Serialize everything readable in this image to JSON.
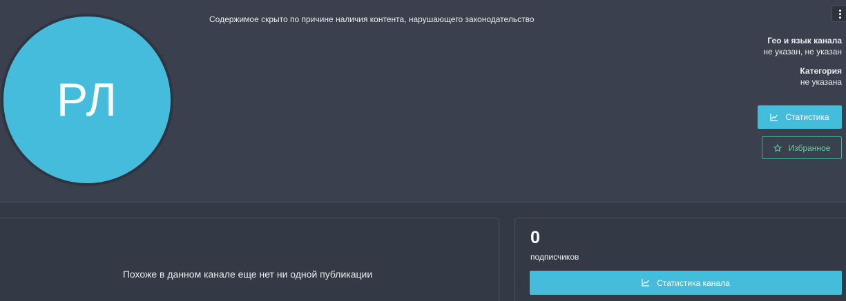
{
  "channel": {
    "initials": "РЛ",
    "hidden_notice": "Содержимое скрыто по причине наличия контента, нарушающего законодательство"
  },
  "sidebar_info": {
    "geo_label": "Гео и язык канала",
    "geo_value": "не указан, не указан",
    "category_label": "Категория",
    "category_value": "не указана"
  },
  "actions": {
    "stats_label": "Статистика",
    "favorite_label": "Избранное"
  },
  "posts": {
    "empty_text": "Похоже в данном канале еще нет ни одной публикации"
  },
  "subscribers": {
    "count": "0",
    "label": "подписчиков",
    "stats_button_label": "Статистика канала"
  },
  "colors": {
    "accent": "#46bcdd",
    "favorite": "#5fd3a2",
    "background": "#343a45",
    "header_background": "#3a404d"
  },
  "icons": {
    "menu": "vertical-dots-icon",
    "stats": "line-chart-icon",
    "favorite": "star-outline-icon"
  }
}
